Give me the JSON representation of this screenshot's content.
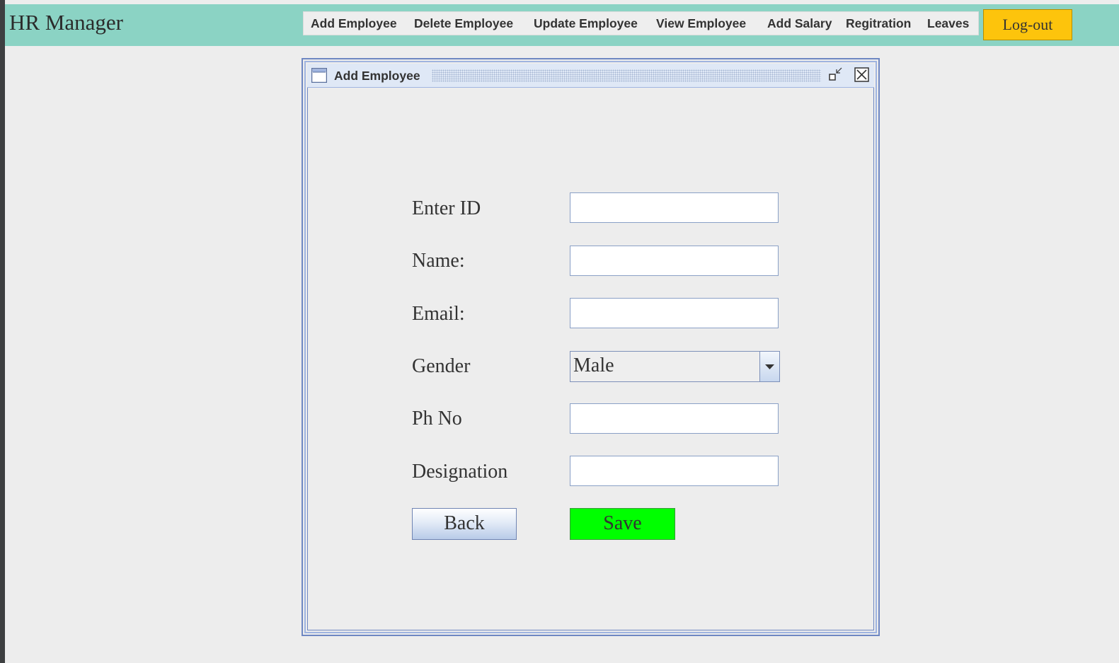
{
  "app": {
    "title": "HR Manager"
  },
  "menu": {
    "items": [
      {
        "label": "Add Employee"
      },
      {
        "label": "Delete Employee"
      },
      {
        "label": "Update Employee"
      },
      {
        "label": "View Employee"
      },
      {
        "label": "Add Salary"
      },
      {
        "label": "Regitration"
      },
      {
        "label": "Leaves"
      }
    ],
    "logout_label": "Log-out"
  },
  "internal_frame": {
    "title": "Add Employee",
    "icons": {
      "frame": "window-icon",
      "restore": "restore-icon",
      "close": "close-icon"
    }
  },
  "form": {
    "enter_id": {
      "label": "Enter ID",
      "value": ""
    },
    "name": {
      "label": "Name:",
      "value": ""
    },
    "email": {
      "label": "Email:",
      "value": ""
    },
    "gender": {
      "label": "Gender",
      "selected": "Male"
    },
    "phone": {
      "label": "Ph No",
      "value": ""
    },
    "designation": {
      "label": "Designation",
      "value": ""
    },
    "back_label": "Back",
    "save_label": "Save"
  },
  "colors": {
    "header": "#8bd3c4",
    "logout": "#fdc40c",
    "save": "#00ff00",
    "frame_border": "#6e87c2"
  }
}
